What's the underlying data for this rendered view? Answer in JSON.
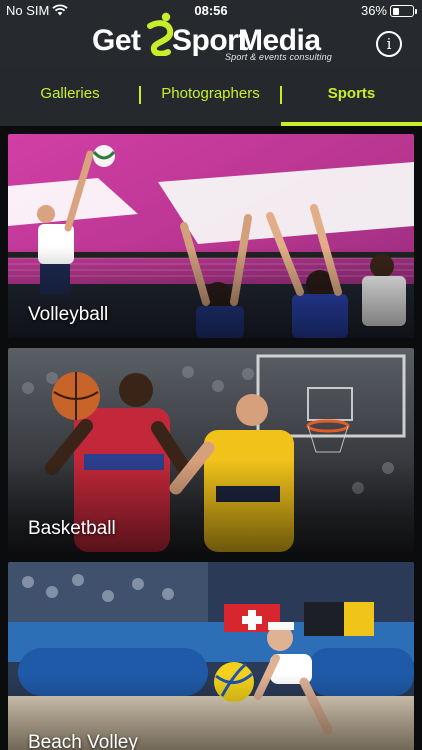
{
  "status": {
    "carrier": "No SIM",
    "time": "08:56",
    "battery_pct": "36%",
    "battery_level": 0.36
  },
  "brand": {
    "word1": "Get",
    "word2": "Sport",
    "word3": "Media",
    "tagline": "Sport & events consulting"
  },
  "header": {
    "info_icon": "info-icon",
    "info_label": "i"
  },
  "tabs": [
    {
      "label": "Galleries",
      "active": false
    },
    {
      "label": "Photographers",
      "active": false
    },
    {
      "label": "Sports",
      "active": true
    }
  ],
  "sports": [
    {
      "name": "Volleyball"
    },
    {
      "name": "Basketball"
    },
    {
      "name": "Beach Volley"
    }
  ],
  "colors": {
    "accent": "#c6ee2a",
    "header_bg": "#262a2f",
    "tabs_bg": "#25292e",
    "page_bg": "#0b0c0d"
  }
}
